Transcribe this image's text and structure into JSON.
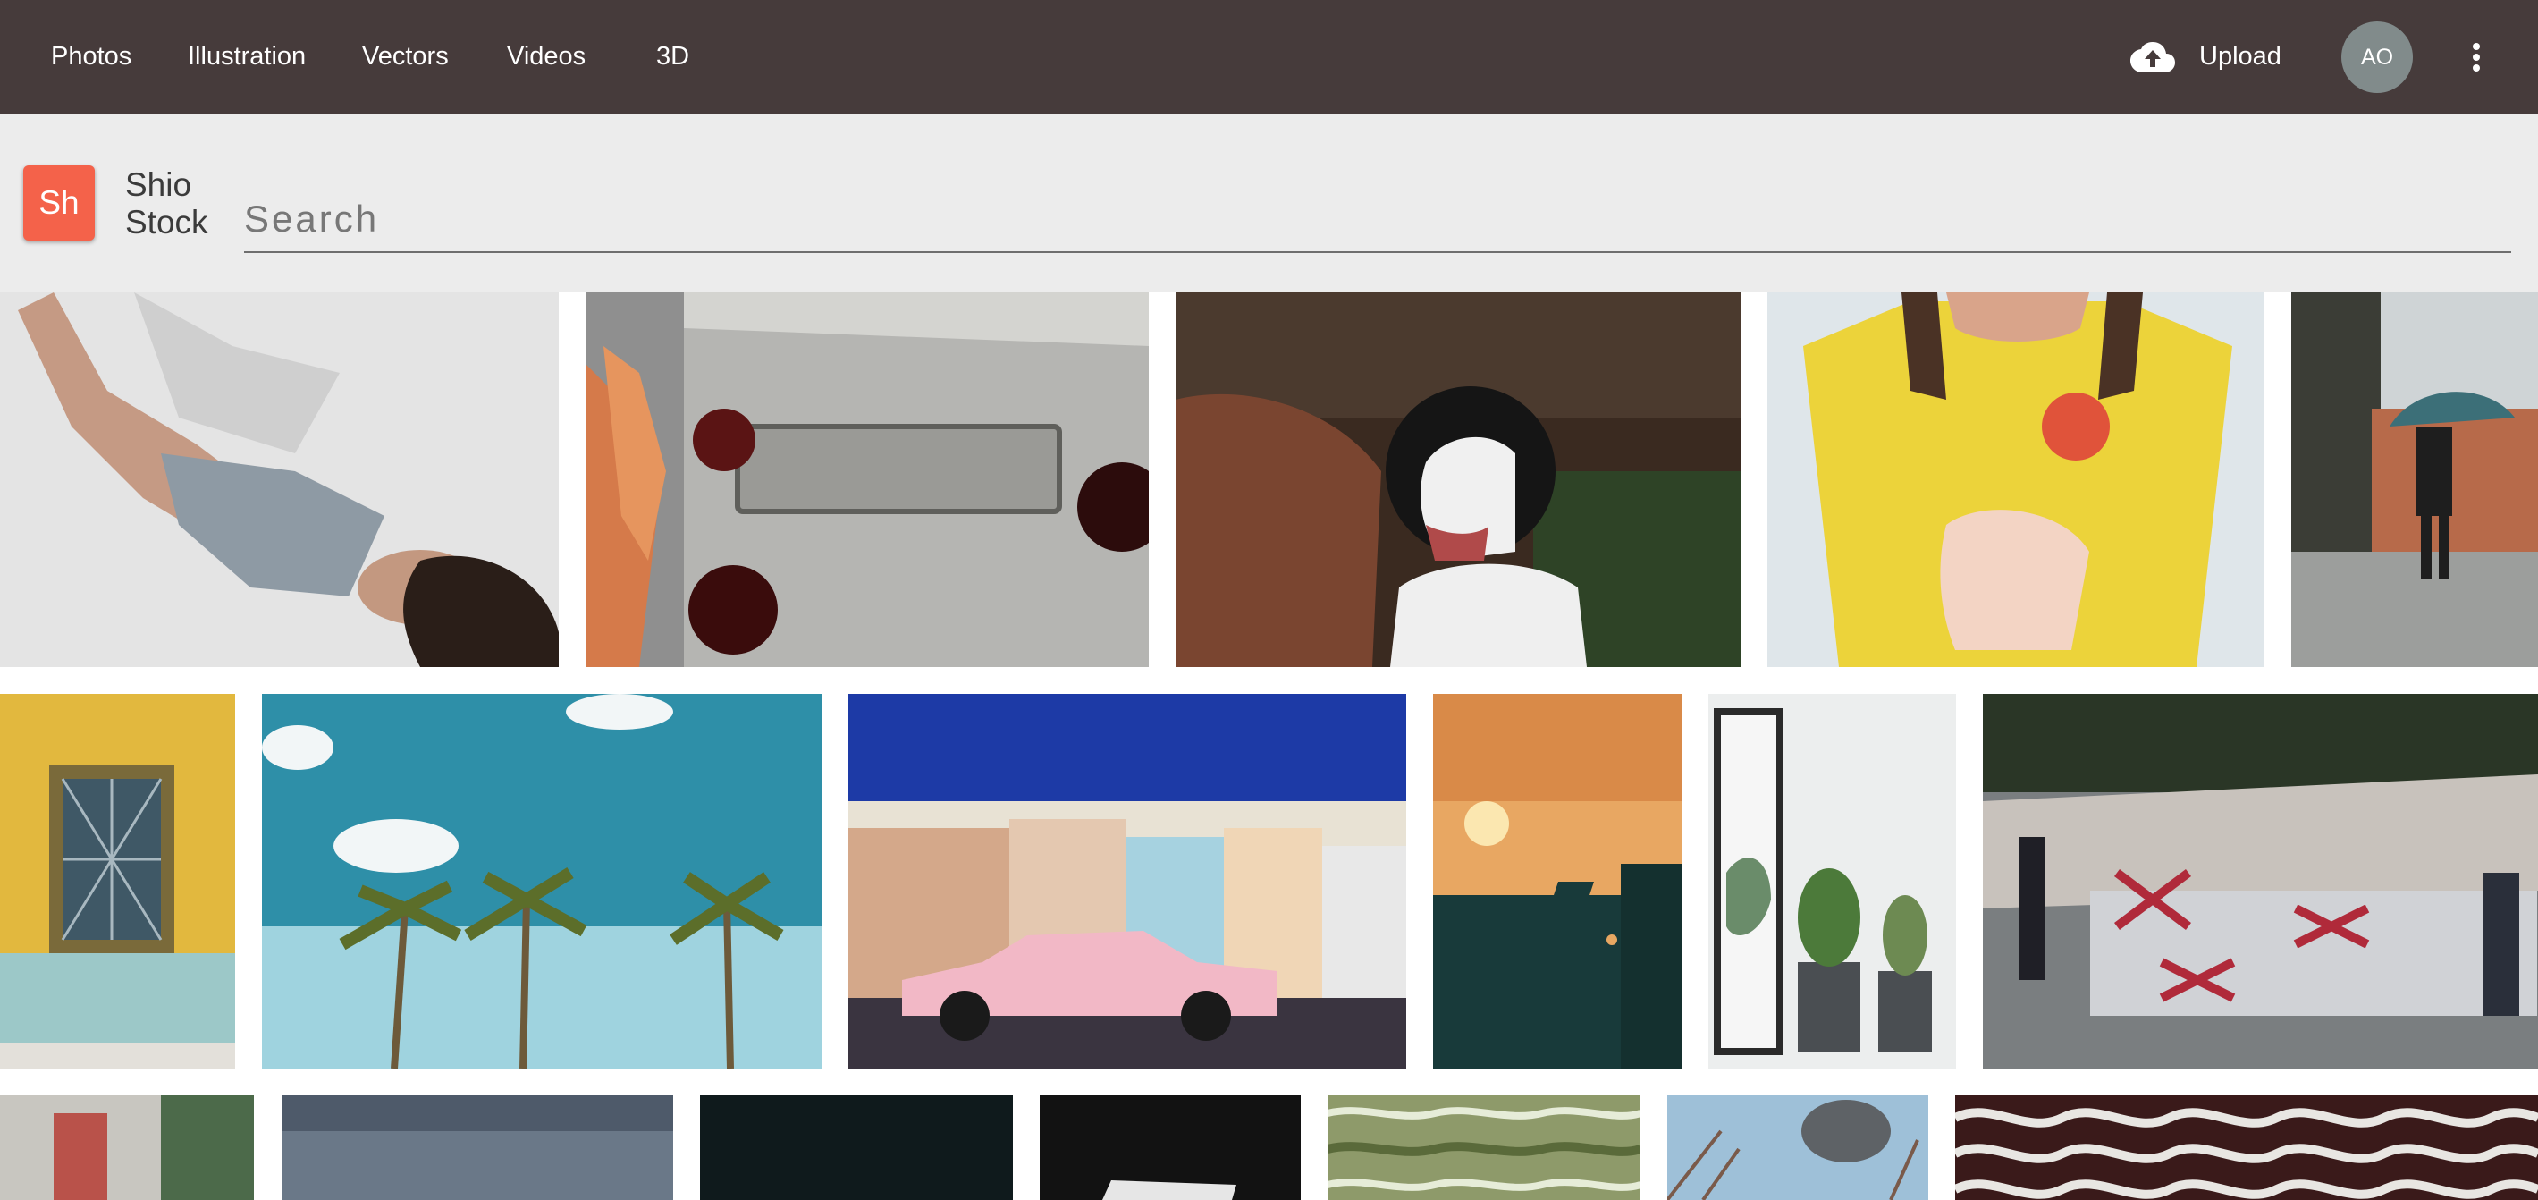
{
  "nav": {
    "links": [
      "Photos",
      "Illustration",
      "Vectors",
      "Videos",
      "3D"
    ],
    "upload_label": "Upload",
    "avatar_initials": "AO"
  },
  "brand": {
    "badge": "Sh",
    "name_line1": "Shio",
    "name_line2": "Stock",
    "accent_color": "#f4624a"
  },
  "search": {
    "placeholder": "Search",
    "value": ""
  },
  "colors": {
    "topbar": "#463b3b",
    "search_strip": "#ececec",
    "avatar": "#818b8b"
  },
  "gallery": {
    "rows": [
      [
        "woman-lying-on-floor",
        "airstream-trailer-detail",
        "border-collie-puppy",
        "woman-yellow-tshirt",
        "person-with-umbrella"
      ],
      [
        "yellow-wall-window",
        "palm-trees-blue-sky",
        "pink-classic-car-havana",
        "sunset-airplane",
        "potted-cacti",
        "crowd-with-flags"
      ],
      [
        "cafe-scene",
        "stormy-sky",
        "dark-photo",
        "dark-frame",
        "water-reflections",
        "smoke-branches",
        "wavy-pattern"
      ]
    ]
  }
}
